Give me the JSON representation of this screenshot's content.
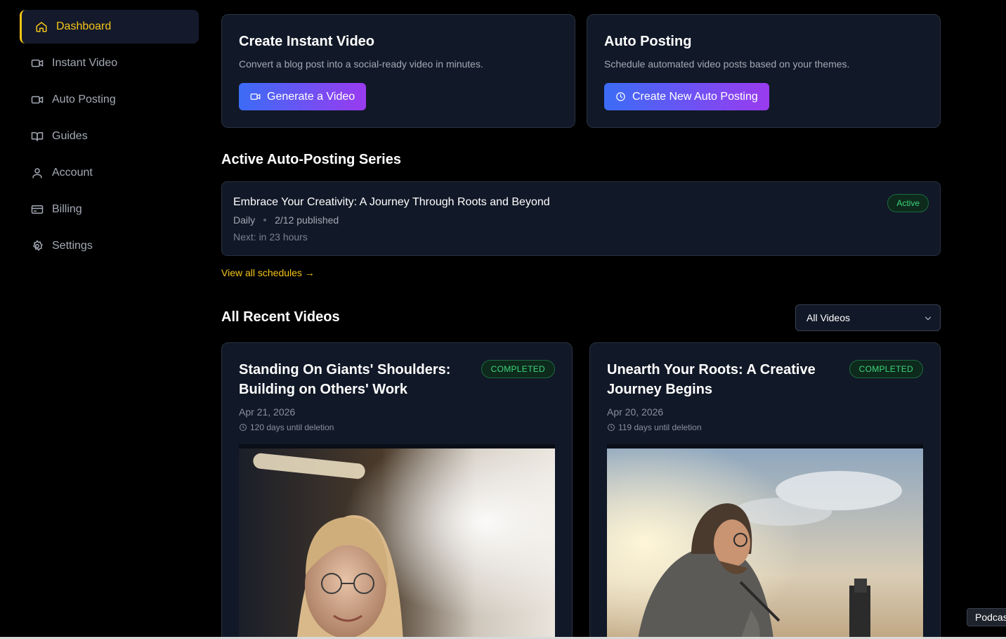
{
  "sidebar": {
    "items": [
      {
        "label": "Dashboard",
        "icon": "home-icon",
        "active": true
      },
      {
        "label": "Instant Video",
        "icon": "video-icon"
      },
      {
        "label": "Auto Posting",
        "icon": "video-icon"
      },
      {
        "label": "Guides",
        "icon": "book-icon"
      },
      {
        "label": "Account",
        "icon": "user-icon"
      },
      {
        "label": "Billing",
        "icon": "credit-card-icon"
      },
      {
        "label": "Settings",
        "icon": "gear-icon"
      }
    ]
  },
  "instant_card": {
    "title": "Create Instant Video",
    "description": "Convert a blog post into a social-ready video in minutes.",
    "button_label": "Generate a Video"
  },
  "auto_card": {
    "title": "Auto Posting",
    "description": "Schedule automated video posts based on your themes.",
    "button_label": "Create New Auto Posting"
  },
  "series_section": {
    "title": "Active Auto-Posting Series",
    "series": {
      "name": "Embrace Your Creativity: A Journey Through Roots and Beyond",
      "frequency": "Daily",
      "published": "2/12 published",
      "next": "Next: in 23 hours",
      "status": "Active"
    },
    "view_all": "View all schedules →"
  },
  "videos_section": {
    "title": "All Recent Videos",
    "filter_value": "All Videos",
    "videos": [
      {
        "title": "Standing On Giants' Shoulders: Building on Others' Work",
        "status": "COMPLETED",
        "date": "Apr 21, 2026",
        "deletion": "120 days until deletion"
      },
      {
        "title": "Unearth Your Roots: A Creative Journey Begins",
        "status": "COMPLETED",
        "date": "Apr 20, 2026",
        "deletion": "119 days until deletion"
      }
    ]
  },
  "tooltip": "Podcas",
  "colors": {
    "accent": "#f5c518",
    "card_bg": "#111827",
    "gradient_start": "#3b6cf6",
    "gradient_end": "#9a3bf0",
    "success": "#3dd57a"
  }
}
